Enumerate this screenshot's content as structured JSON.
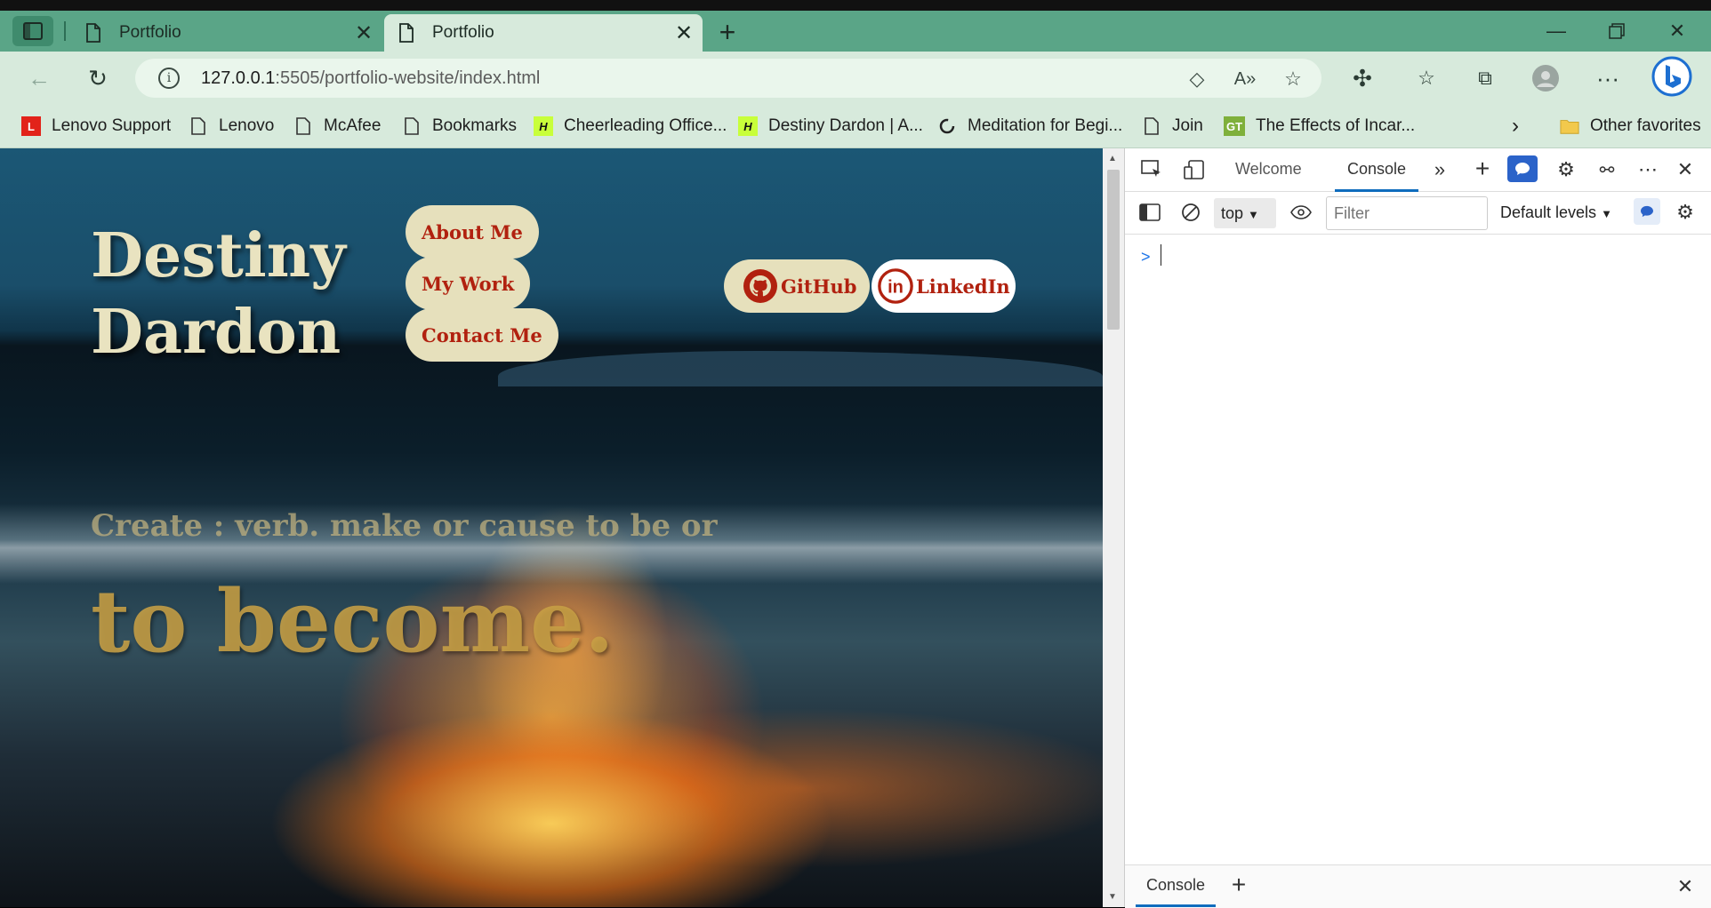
{
  "browser": {
    "tabs": [
      {
        "title": "Portfolio",
        "active": false
      },
      {
        "title": "Portfolio",
        "active": true
      }
    ],
    "url_host": "127.0.0.1",
    "url_rest": ":5505/portfolio-website/index.html",
    "bookmarks": [
      {
        "label": "Lenovo Support",
        "icon": "lenovo-l-icon"
      },
      {
        "label": "Lenovo",
        "icon": "page-icon"
      },
      {
        "label": "McAfee",
        "icon": "page-icon"
      },
      {
        "label": "Bookmarks",
        "icon": "page-icon"
      },
      {
        "label": "Cheerleading Office...",
        "icon": "h-badge-icon"
      },
      {
        "label": "Destiny Dardon | A...",
        "icon": "h-badge-icon"
      },
      {
        "label": "Meditation for Begi...",
        "icon": "loading-ring-icon"
      },
      {
        "label": "Join",
        "icon": "page-icon"
      },
      {
        "label": "The Effects of Incar...",
        "icon": "gt-badge-icon"
      }
    ],
    "other_favorites": "Other favorites",
    "colors": {
      "tabstrip": "#5aa587",
      "toolbar": "#d7eadc"
    }
  },
  "page": {
    "title_line1": "Destiny",
    "title_line2": "Dardon",
    "nav": [
      "About Me",
      "My Work",
      "Contact Me"
    ],
    "github": "GitHub",
    "linkedin": "LinkedIn",
    "tagline": "Create : verb. make or cause to be or",
    "hero": "to become.",
    "colors": {
      "pill": "#e6e0bc",
      "link_red": "#b1210f"
    }
  },
  "devtools": {
    "tabs": [
      "Welcome",
      "Console"
    ],
    "active_tab": "Console",
    "context": "top",
    "filter_placeholder": "Filter",
    "levels": "Default levels",
    "prompt": ">",
    "drawer_tab": "Console"
  }
}
